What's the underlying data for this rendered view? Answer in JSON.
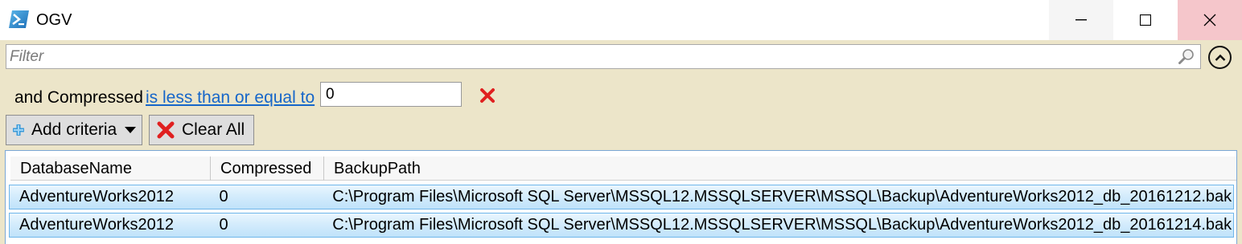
{
  "window": {
    "title": "OGV",
    "icon": "powershell-icon"
  },
  "filter": {
    "placeholder": "Filter",
    "value": ""
  },
  "criteria": {
    "label": "and Compressed",
    "operator": "is less than or equal to",
    "value": "0"
  },
  "toolbar": {
    "add_label": "Add criteria",
    "clear_label": "Clear All"
  },
  "grid": {
    "columns": [
      "DatabaseName",
      "Compressed",
      "BackupPath"
    ],
    "rows": [
      [
        "AdventureWorks2012",
        "0",
        "C:\\Program Files\\Microsoft SQL Server\\MSSQL12.MSSQLSERVER\\MSSQL\\Backup\\AdventureWorks2012_db_20161212.bak"
      ],
      [
        "AdventureWorks2012",
        "0",
        "C:\\Program Files\\Microsoft SQL Server\\MSSQL12.MSSQLSERVER\\MSSQL\\Backup\\AdventureWorks2012_db_20161214.bak"
      ]
    ]
  },
  "colors": {
    "panel": "#ece5c9",
    "link": "#1666c9",
    "selection": "#cde8fb",
    "close_hover": "#f5c6cb"
  }
}
